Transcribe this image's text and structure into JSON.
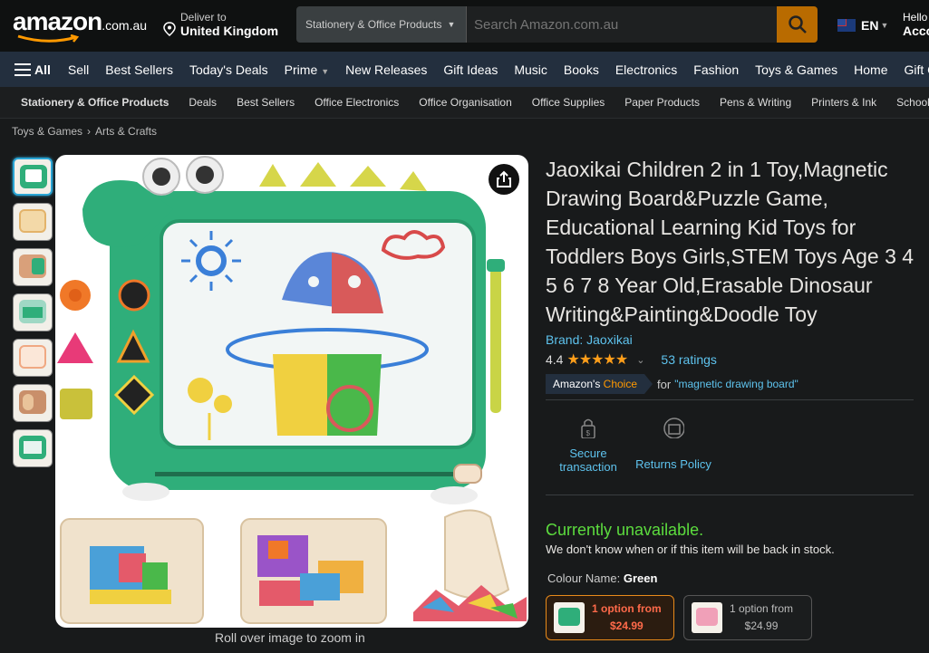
{
  "header": {
    "logo_word": "amazon",
    "logo_tld": ".com.au",
    "deliver_line1": "Deliver to",
    "deliver_line2": "United Kingdom",
    "search_category": "Stationery & Office Products",
    "search_placeholder": "Search Amazon.com.au",
    "lang": "EN",
    "hello_line1": "Hello",
    "hello_line2": "Acco"
  },
  "nav": {
    "all_label": "All",
    "items": [
      "Sell",
      "Best Sellers",
      "Today's Deals",
      "Prime",
      "New Releases",
      "Gift Ideas",
      "Music",
      "Books",
      "Electronics",
      "Fashion",
      "Toys & Games",
      "Home",
      "Gift C"
    ]
  },
  "subnav": {
    "items": [
      "Stationery & Office Products",
      "Deals",
      "Best Sellers",
      "Office Electronics",
      "Office Organisation",
      "Office Supplies",
      "Paper Products",
      "Pens & Writing",
      "Printers & Ink",
      "School"
    ]
  },
  "breadcrumb": [
    "Toys & Games",
    "Arts & Crafts"
  ],
  "breadcrumb_sep": "›",
  "image": {
    "rollover": "Roll over image to zoom in"
  },
  "product": {
    "title": "Jaoxikai Children 2 in 1 Toy,Magnetic Drawing Board&Puzzle Game, Educational Learning Kid Toys for Toddlers Boys Girls,STEM Toys Age 3 4 5 6 7 8 Year Old,Erasable Dinosaur Writing&Painting&Doodle Toy",
    "brand": "Brand: Jaoxikai",
    "rating": "4.4",
    "stars": "★★★★★",
    "ratings_count": "53 ratings",
    "choice_badge_a": "Amazon's",
    "choice_badge_b": "Choice",
    "choice_for": "for",
    "choice_query": "\"magnetic drawing board\"",
    "secure_line1": "Secure",
    "secure_line2": "transaction",
    "returns": "Returns Policy",
    "availability": "Currently unavailable.",
    "stock_note": "We don't know when or if this item will be back in stock.",
    "colour_label": "Colour Name:",
    "colour_value": "Green",
    "options": [
      {
        "line1": "1 option from",
        "price": "$24.99"
      },
      {
        "line1": "1 option from",
        "price": "$24.99"
      }
    ]
  },
  "colors": {
    "accent_orange": "#f90",
    "link_blue": "#5ec3ee",
    "available_green": "#5cdc3e",
    "toy_green": "#2fae7a"
  }
}
